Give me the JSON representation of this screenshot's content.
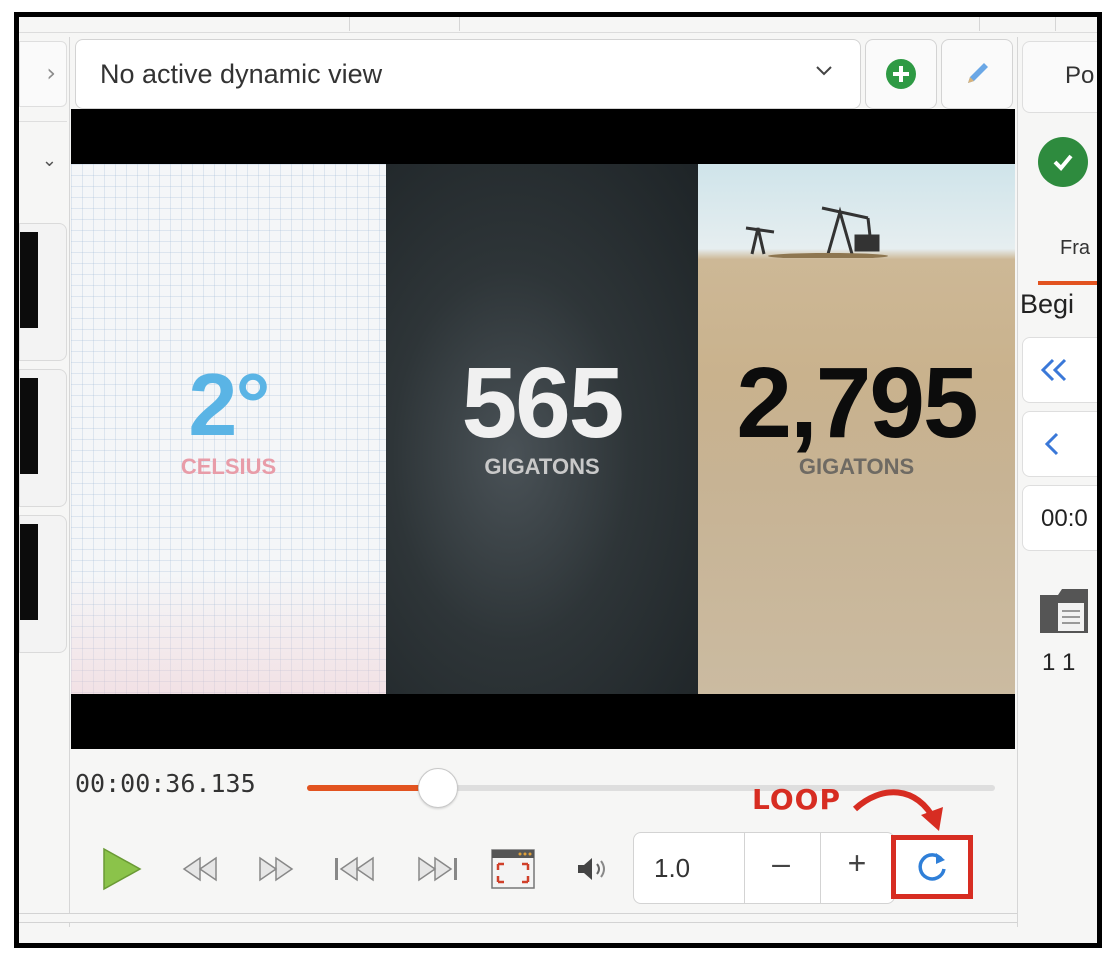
{
  "dynamic_view": {
    "select_label": "No active dynamic view",
    "add_icon": "plus-circle-icon",
    "edit_icon": "pencil-icon"
  },
  "left_panel": {
    "expand_icon": "chevron-right-icon",
    "collapse_icon": "chevron-down-icon"
  },
  "video": {
    "panels": [
      {
        "number": "2°",
        "unit": "CELSIUS"
      },
      {
        "number": "565",
        "unit": "GIGATONS"
      },
      {
        "number": "2,795",
        "unit": "GIGATONS"
      }
    ]
  },
  "playback": {
    "current_time": "00:00:36.135",
    "progress_fraction": 0.19,
    "play_icon": "play-icon",
    "rewind_icon": "rewind-icon",
    "fast_forward_icon": "fast-forward-icon",
    "skip_start_icon": "skip-start-icon",
    "skip_end_icon": "skip-end-icon",
    "fullscreen_icon": "fullscreen-icon",
    "volume_icon": "volume-icon",
    "rate": "1.0",
    "rate_decrease": "–",
    "rate_increase": "+",
    "loop_icon": "loop-icon"
  },
  "annotation": {
    "loop_label": "LOOP"
  },
  "right_panel": {
    "tab_label": "Po",
    "subtab_label": "Fra",
    "begin_label": "Begi",
    "time_value": "00:0",
    "count_text": "1 1"
  },
  "colors": {
    "accent_orange": "#e2531f",
    "annotation_red": "#d72d22",
    "celsius_blue": "#5ab4e5",
    "celsius_pink": "#e89ca8",
    "play_green": "#8bc34a",
    "check_green": "#2e8b3e"
  }
}
